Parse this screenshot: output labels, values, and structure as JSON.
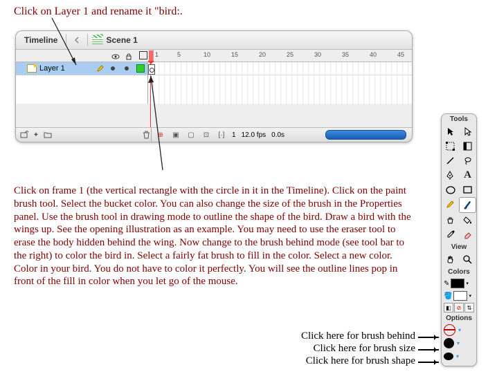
{
  "top_instruction": "Click on Layer 1 and rename it \"bird:.",
  "timeline": {
    "tab": "Timeline",
    "scene": "Scene 1",
    "layer_name": "Layer 1",
    "ruler": [
      "1",
      "5",
      "10",
      "15",
      "20",
      "25",
      "30",
      "35",
      "40",
      "45"
    ],
    "frame_num": "1",
    "fps": "12.0 fps",
    "time": "0.0s"
  },
  "paragraph": "Click on frame 1 (the vertical rectangle with the circle in it in the Timeline).  Click on the paint brush tool. Select the bucket color.  You can also change the size of the brush in the Properties panel.  Use the brush tool in  drawing mode to outline the shape of the bird.  Draw a bird with the wings up. See the opening illustration as an example.   You may need to use the eraser tool to erase the body hidden behind the wing.  Now change to the brush behind mode (see tool bar to the right) to color the bird in.   Select a fairly fat brush to fill in the color.   Select a new color. Color in your bird.  You do not have to color it perfectly. You will see the outline lines pop in front of the fill in color when you let go of the mouse.",
  "tools_panel": {
    "title": "Tools",
    "view": "View",
    "colors": "Colors",
    "options": "Options",
    "stroke_color": "#000000",
    "fill_color": "#ffffff"
  },
  "right_labels": {
    "l1": "Click here for brush behind",
    "l2": "Click here for brush size",
    "l3": "Click here for brush shape"
  }
}
